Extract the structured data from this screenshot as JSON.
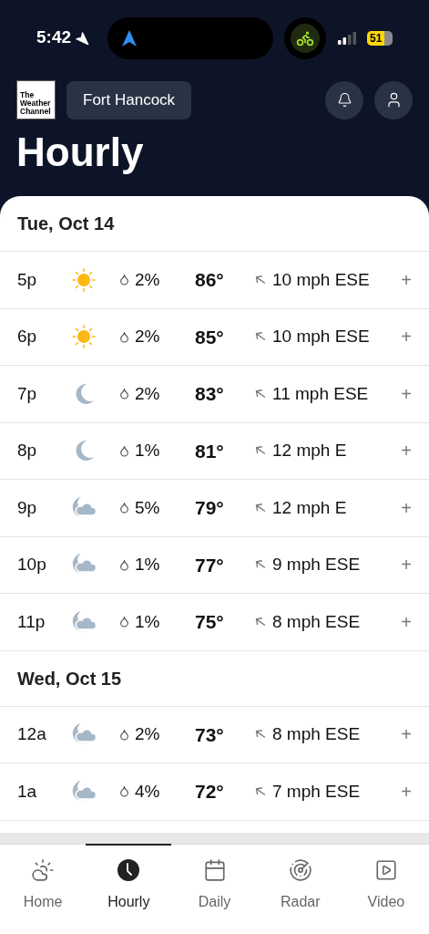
{
  "status_bar": {
    "time": "5:42",
    "battery": "51"
  },
  "header": {
    "logo": "The Weather Channel",
    "location": "Fort Hancock",
    "title": "Hourly"
  },
  "sections": [
    {
      "date": "Tue, Oct 14",
      "rows": [
        {
          "time": "5p",
          "kind": "sunny",
          "precip": "2%",
          "temp": "86°",
          "wind": "10 mph ESE",
          "expand": "+"
        },
        {
          "time": "6p",
          "kind": "sunny",
          "precip": "2%",
          "temp": "85°",
          "wind": "10 mph ESE",
          "expand": "+"
        },
        {
          "time": "7p",
          "kind": "clear",
          "precip": "2%",
          "temp": "83°",
          "wind": "11 mph ESE",
          "expand": "+"
        },
        {
          "time": "8p",
          "kind": "clear",
          "precip": "1%",
          "temp": "81°",
          "wind": "12 mph E",
          "expand": "+"
        },
        {
          "time": "9p",
          "kind": "cloudy",
          "precip": "5%",
          "temp": "79°",
          "wind": "12 mph E",
          "expand": "+"
        },
        {
          "time": "10p",
          "kind": "cloudy",
          "precip": "1%",
          "temp": "77°",
          "wind": "9 mph ESE",
          "expand": "+"
        },
        {
          "time": "11p",
          "kind": "cloudy",
          "precip": "1%",
          "temp": "75°",
          "wind": "8 mph ESE",
          "expand": "+"
        }
      ]
    },
    {
      "date": "Wed, Oct 15",
      "rows": [
        {
          "time": "12a",
          "kind": "cloudy",
          "precip": "2%",
          "temp": "73°",
          "wind": "8 mph ESE",
          "expand": "+"
        },
        {
          "time": "1a",
          "kind": "cloudy",
          "precip": "4%",
          "temp": "72°",
          "wind": "7 mph ESE",
          "expand": "+"
        }
      ]
    }
  ],
  "tabs": [
    {
      "label": "Home",
      "selected": false
    },
    {
      "label": "Hourly",
      "selected": true
    },
    {
      "label": "Daily",
      "selected": false
    },
    {
      "label": "Radar",
      "selected": false
    },
    {
      "label": "Video",
      "selected": false
    }
  ]
}
